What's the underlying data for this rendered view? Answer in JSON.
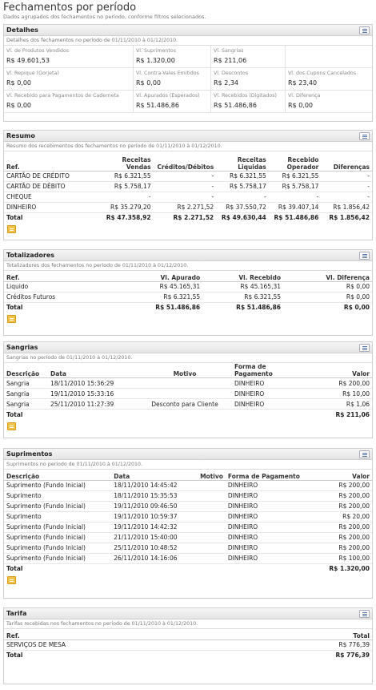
{
  "header": {
    "title": "Fechamentos por período",
    "subtitle": "Dados agrupados dos fechamentos no período, conforme filtros selecionados."
  },
  "detalhes": {
    "title": "Detalhes",
    "description": "Detalhes dos fechamentos no período de 01/11/2010 à 01/12/2010.",
    "fields": [
      {
        "label": "Vl. de Produtos Vendidos",
        "value": "R$ 49.601,53"
      },
      {
        "label": "Vl. Suprimentos",
        "value": "R$ 1.320,00"
      },
      {
        "label": "Vl. Sangrias",
        "value": "R$ 211,06"
      },
      {
        "label": "",
        "value": ""
      },
      {
        "label": "Vl. Repique (Gorjeta)",
        "value": "R$ 0,00"
      },
      {
        "label": "Vl. Contra-Vales Emitidos",
        "value": "R$ 0,00"
      },
      {
        "label": "Vl. Descontos",
        "value": "R$ 2,34"
      },
      {
        "label": "Vl. dos Cupons Cancelados",
        "value": "R$ 23,40"
      },
      {
        "label": "Vl. Recebido para Pagamentos de Caderneta",
        "value": "R$ 0,00"
      },
      {
        "label": "Vl. Apurados (Esperados)",
        "value": "R$ 51.486,86"
      },
      {
        "label": "Vl. Recebidos (Digitados)",
        "value": "R$ 51.486,86"
      },
      {
        "label": "Vl. Diferença",
        "value": "R$ 0,00"
      }
    ]
  },
  "resumo": {
    "title": "Resumo",
    "description": "Resumo dos recebimentos dos fechamentos no período de 01/11/2010 à 01/12/2010.",
    "columns": [
      "Ref.",
      "Receitas Vendas",
      "Créditos/Débitos",
      "Receitas Liquidas",
      "Recebido Operador",
      "Diferenças"
    ],
    "rows": [
      [
        "CARTÃO DE CRÉDITO",
        "R$ 6.321,55",
        "-",
        "R$ 6.321,55",
        "R$ 6.321,55",
        "-"
      ],
      [
        "CARTÃO DE DÉBITO",
        "R$ 5.758,17",
        "-",
        "R$ 5.758,17",
        "R$ 5.758,17",
        "-"
      ],
      [
        "CHEQUE",
        "-",
        "-",
        "-",
        "-",
        "-"
      ],
      [
        "DINHEIRO",
        "R$ 35.279,20",
        "R$ 2.271,52",
        "R$ 37.550,72",
        "R$ 39.407,14",
        "R$ 1.856,42"
      ]
    ],
    "total": [
      "Total",
      "R$ 47.358,92",
      "R$ 2.271,52",
      "R$ 49.630,44",
      "R$ 51.486,86",
      "R$ 1.856,42"
    ]
  },
  "totalizadores": {
    "title": "Totalizadores",
    "description": "Totalizadores dos fechamentos no período de 01/11/2010 à 01/12/2010.",
    "columns": [
      "Ref.",
      "Vl. Apurado",
      "Vl. Recebido",
      "Vl. Diferença"
    ],
    "rows": [
      [
        "Liquido",
        "R$ 45.165,31",
        "R$ 45.165,31",
        "R$ 0,00"
      ],
      [
        "Créditos Futuros",
        "R$ 6.321,55",
        "R$ 6.321,55",
        "R$ 0,00"
      ]
    ],
    "total": [
      "Total",
      "R$ 51.486,86",
      "R$ 51.486,86",
      "R$ 0,00"
    ]
  },
  "sangrias": {
    "title": "Sangrias",
    "description": "Sangrias no período de 01/11/2010 à 01/12/2010.",
    "columns": [
      "Descrição",
      "Data",
      "Motivo",
      "Forma de Pagamento",
      "Valor"
    ],
    "rows": [
      [
        "Sangria",
        "18/11/2010 15:36:29",
        "",
        "DINHEIRO",
        "R$ 200,00"
      ],
      [
        "Sangria",
        "19/11/2010 15:33:16",
        "",
        "DINHEIRO",
        "R$ 10,00"
      ],
      [
        "Sangria",
        "25/11/2010 11:27:39",
        "Desconto para Cliente",
        "DINHEIRO",
        "R$ 1,06"
      ]
    ],
    "total": [
      "Total",
      "R$ 211,06"
    ]
  },
  "suprimentos": {
    "title": "Suprimentos",
    "description": "Suprimentos no período de 01/11/2010 à 01/12/2010.",
    "columns": [
      "Descrição",
      "Data",
      "Motivo",
      "Forma de Pagamento",
      "Valor"
    ],
    "rows": [
      [
        "Suprimento (Fundo Inicial)",
        "18/11/2010 14:45:42",
        "",
        "DINHEIRO",
        "R$ 200,00"
      ],
      [
        "Suprimento",
        "18/11/2010 15:35:53",
        "",
        "DINHEIRO",
        "R$ 200,00"
      ],
      [
        "Suprimento (Fundo Inicial)",
        "19/11/2010 09:46:50",
        "",
        "DINHEIRO",
        "R$ 200,00"
      ],
      [
        "Suprimento",
        "19/11/2010 10:59:37",
        "",
        "DINHEIRO",
        "R$ 20,00"
      ],
      [
        "Suprimento (Fundo Inicial)",
        "19/11/2010 14:42:32",
        "",
        "DINHEIRO",
        "R$ 200,00"
      ],
      [
        "Suprimento (Fundo Inicial)",
        "21/11/2010 15:40:00",
        "",
        "DINHEIRO",
        "R$ 200,00"
      ],
      [
        "Suprimento (Fundo Inicial)",
        "25/11/2010 10:48:52",
        "",
        "DINHEIRO",
        "R$ 200,00"
      ],
      [
        "Suprimento (Fundo Inicial)",
        "26/11/2010 14:16:06",
        "",
        "DINHEIRO",
        "R$ 100,00"
      ]
    ],
    "total": [
      "Total",
      "R$ 1.320,00"
    ]
  },
  "tarifa": {
    "title": "Tarifa",
    "description": "Tarifas recebidas nos fechamentos no período de 01/11/2010 à 01/12/2010.",
    "columns": [
      "Ref.",
      "Total"
    ],
    "rows": [
      [
        "SERVIÇOS DE MESA",
        "R$ 776,39"
      ]
    ],
    "total": [
      "Total",
      "R$ 776,39"
    ]
  },
  "icons": {
    "panel_menu": "list-menu-icon",
    "export": "export-document-icon"
  },
  "colors": {
    "panel_header": "#e8e8e8",
    "export_icon": "#f3c248",
    "title_text": "#333333"
  }
}
